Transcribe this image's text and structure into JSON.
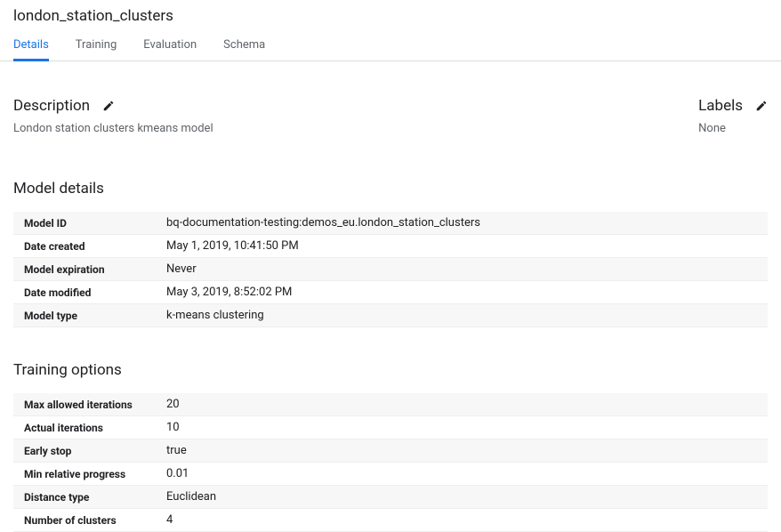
{
  "page": {
    "title": "london_station_clusters"
  },
  "tabs": {
    "details": "Details",
    "training": "Training",
    "evaluation": "Evaluation",
    "schema": "Schema"
  },
  "description": {
    "heading": "Description",
    "value": "London station clusters kmeans model"
  },
  "labels": {
    "heading": "Labels",
    "value": "None"
  },
  "model_details": {
    "heading": "Model details",
    "rows": {
      "model_id_k": "Model ID",
      "model_id_v": "bq-documentation-testing:demos_eu.london_station_clusters",
      "date_created_k": "Date created",
      "date_created_v": "May 1, 2019, 10:41:50 PM",
      "model_expiration_k": "Model expiration",
      "model_expiration_v": "Never",
      "date_modified_k": "Date modified",
      "date_modified_v": "May 3, 2019, 8:52:02 PM",
      "model_type_k": "Model type",
      "model_type_v": "k-means clustering"
    }
  },
  "training_options": {
    "heading": "Training options",
    "rows": {
      "max_iter_k": "Max allowed iterations",
      "max_iter_v": "20",
      "actual_iter_k": "Actual iterations",
      "actual_iter_v": "10",
      "early_stop_k": "Early stop",
      "early_stop_v": "true",
      "min_rel_prog_k": "Min relative progress",
      "min_rel_prog_v": "0.01",
      "distance_k": "Distance type",
      "distance_v": "Euclidean",
      "clusters_k": "Number of clusters",
      "clusters_v": "4"
    }
  }
}
